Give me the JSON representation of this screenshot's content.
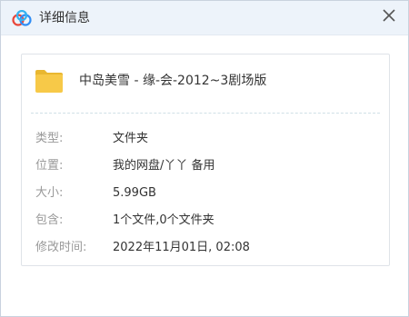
{
  "window": {
    "title": "详细信息",
    "app_icon": "baidu-netdisk-logo-icon",
    "close_icon": "close-icon"
  },
  "file": {
    "icon": "folder-icon",
    "icon_color": "#f7c948",
    "name": "中岛美雪 - 缘-会-2012~3剧场版"
  },
  "details": [
    {
      "label": "类型:",
      "value": "文件夹"
    },
    {
      "label": "位置:",
      "value": "我的网盘/丫丫 备用"
    },
    {
      "label": "大小:",
      "value": "5.99GB"
    },
    {
      "label": "包含:",
      "value": "1个文件,0个文件夹"
    },
    {
      "label": "修改时间:",
      "value": "2022年11月01日, 02:08"
    }
  ]
}
